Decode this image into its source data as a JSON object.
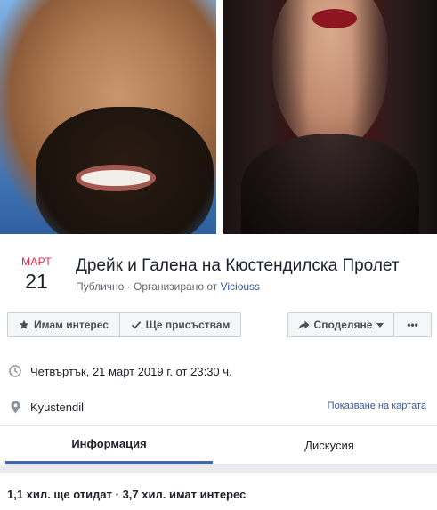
{
  "cover": {
    "left_image": "portrait-photo-man",
    "right_image": "portrait-photo-woman"
  },
  "event": {
    "date_month": "МАРТ",
    "date_day": "21",
    "title": "Дрейк и Галена на Кюстендилска Пролет",
    "privacy": "Публично",
    "separator": " · ",
    "organized_by": "Организирано от ",
    "organizer": "Viciouss"
  },
  "actions": {
    "interested_label": "Имам интерес",
    "interested_icon": "star-icon",
    "going_label": "Ще присъствам",
    "going_icon": "checkmark-icon",
    "share_label": "Споделяне",
    "share_icon": "share-arrow-icon",
    "more_label": "•••"
  },
  "details": {
    "time": "Четвъртък, 21 март 2019 г. от 23:30 ч.",
    "time_icon": "clock-icon",
    "place": "Kyustendil",
    "place_icon": "location-pin-icon",
    "map_link": "Показване на картата"
  },
  "tabs": [
    {
      "label": "Информация",
      "active": true
    },
    {
      "label": "Дискусия",
      "active": false
    }
  ],
  "stats": "1,1 хил. ще отидат · 3,7 хил. имат интерес",
  "colors": {
    "date_month": "#f02849",
    "link": "#385898",
    "active_tab_underline": "#4267b2",
    "button_bg": "#f5f6f7"
  }
}
